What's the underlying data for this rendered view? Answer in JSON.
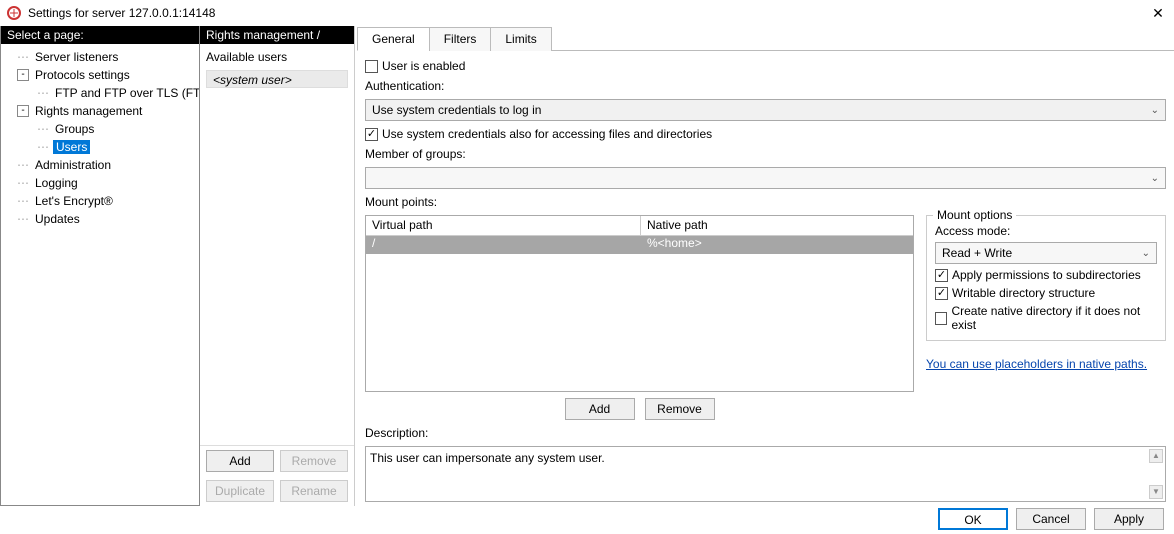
{
  "window": {
    "title": "Settings for server 127.0.0.1:14148",
    "close_glyph": "✕"
  },
  "sidebar": {
    "header": "Select a page:",
    "items": [
      {
        "label": "Server listeners",
        "level": 1,
        "toggle": null
      },
      {
        "label": "Protocols settings",
        "level": 1,
        "toggle": "-"
      },
      {
        "label": "FTP and FTP over TLS (FTPS)",
        "level": 2,
        "toggle": null
      },
      {
        "label": "Rights management",
        "level": 1,
        "toggle": "-"
      },
      {
        "label": "Groups",
        "level": 2,
        "toggle": null
      },
      {
        "label": "Users",
        "level": 2,
        "toggle": null,
        "selected": true
      },
      {
        "label": "Administration",
        "level": 1,
        "toggle": null
      },
      {
        "label": "Logging",
        "level": 1,
        "toggle": null
      },
      {
        "label": "Let's Encrypt®",
        "level": 1,
        "toggle": null
      },
      {
        "label": "Updates",
        "level": 1,
        "toggle": null
      }
    ]
  },
  "users_panel": {
    "header": "Rights management / Users",
    "caption": "Available users",
    "items": [
      "<system user>"
    ],
    "buttons": {
      "add": "Add",
      "remove": "Remove",
      "duplicate": "Duplicate",
      "rename": "Rename"
    }
  },
  "tabs": {
    "general": "General",
    "filters": "Filters",
    "limits": "Limits"
  },
  "general": {
    "user_enabled_label": "User is enabled",
    "authentication_label": "Authentication:",
    "auth_select_value": "Use system credentials to log in",
    "cred_files_label": "Use system credentials also for accessing files and directories",
    "member_label": "Member of groups:",
    "member_value": "",
    "mount_points_label": "Mount points:",
    "mount_headers": {
      "virtual": "Virtual path",
      "native": "Native path"
    },
    "mount_rows": [
      {
        "virtual": "/",
        "native": "%<home>"
      }
    ],
    "mount_buttons": {
      "add": "Add",
      "remove": "Remove"
    },
    "mount_options": {
      "legend": "Mount options",
      "access_label": "Access mode:",
      "access_value": "Read + Write",
      "apply_perms": "Apply permissions to subdirectories",
      "writable_dir": "Writable directory structure",
      "create_native": "Create native directory if it does not exist",
      "placeholders_link": "You can use placeholders in native paths."
    },
    "description_label": "Description:",
    "description_value": "This user can impersonate any system user."
  },
  "footer": {
    "ok": "OK",
    "cancel": "Cancel",
    "apply": "Apply"
  }
}
